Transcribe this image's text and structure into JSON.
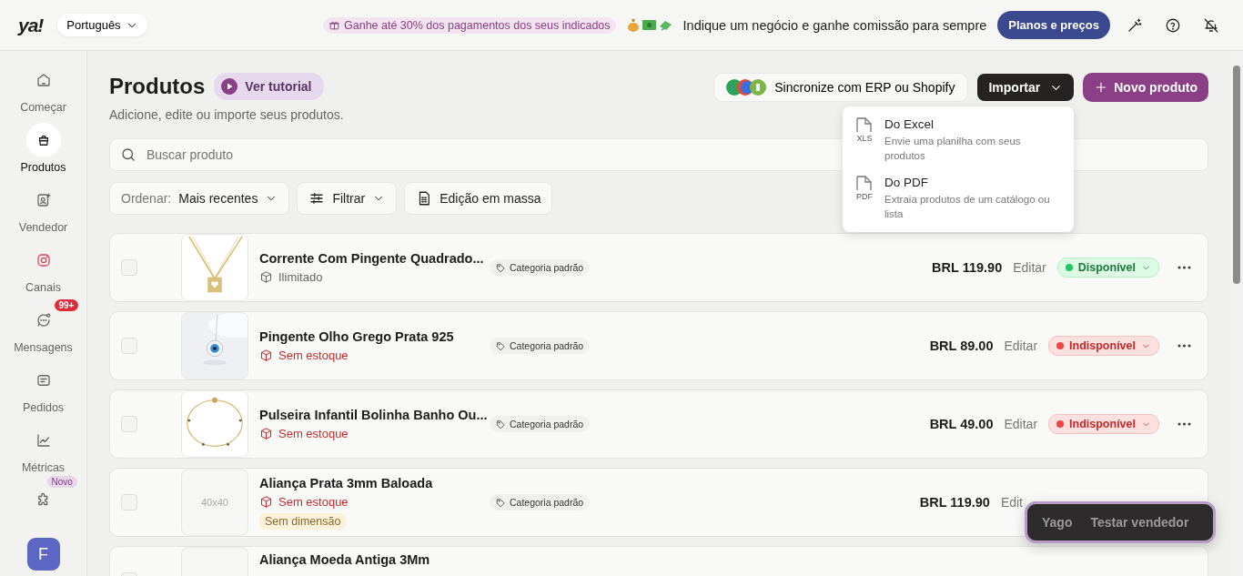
{
  "topbar": {
    "logo": "ya!",
    "language": "Português",
    "promo": "Ganhe até 30% dos pagamentos dos seus indicados",
    "referral": "Indique um negócio e ganhe comissão para sempre",
    "plans_button": "Planos e preços"
  },
  "sidebar": {
    "items": [
      {
        "kind": "home",
        "label": "Começar",
        "selected": false
      },
      {
        "kind": "products",
        "label": "Produtos",
        "selected": true
      },
      {
        "kind": "seller",
        "label": "Vendedor",
        "selected": false
      },
      {
        "kind": "channels",
        "label": "Canais",
        "selected": false
      },
      {
        "kind": "messages",
        "label": "Mensagens",
        "selected": false,
        "badge": "99+"
      },
      {
        "kind": "orders",
        "label": "Pedidos",
        "selected": false
      },
      {
        "kind": "metrics",
        "label": "Métricas",
        "selected": false
      },
      {
        "kind": "extensions",
        "selected": false,
        "badge": "Novo"
      }
    ],
    "avatar": "F"
  },
  "header": {
    "title": "Produtos",
    "tutorial_button": "Ver tutorial",
    "subtitle": "Adicione, edite ou importe seus produtos.",
    "sync_button": "Sincronize com ERP ou Shopify",
    "import_button": "Importar",
    "new_button": "Novo produto"
  },
  "import_menu": {
    "items": [
      {
        "title": "Do Excel",
        "description": "Envie uma planilha com seus produtos",
        "file_type": "XLS"
      },
      {
        "title": "Do PDF",
        "description": "Extraia produtos de um catálogo ou lista",
        "file_type": "PDF"
      }
    ]
  },
  "search": {
    "placeholder": "Buscar produto"
  },
  "toolbar": {
    "sort_label": "Ordenar:",
    "sort_value": "Mais recentes",
    "filter": "Filtrar",
    "bulk_edit": "Edição em massa"
  },
  "products": [
    {
      "checked": false,
      "name": "Corrente Com Pingente Quadrado...",
      "stock": "Ilimitado",
      "out_of_stock": false,
      "category": "Categoria padrão",
      "price": "BRL 119.90",
      "edit": "Editar",
      "status": "Disponível",
      "available": true
    },
    {
      "checked": false,
      "name": "Pingente Olho Grego Prata 925",
      "stock": "Sem estoque",
      "out_of_stock": true,
      "category": "Categoria padrão",
      "price": "BRL 89.00",
      "edit": "Editar",
      "status": "Indisponível",
      "available": false
    },
    {
      "checked": false,
      "name": "Pulseira Infantil Bolinha Banho Ou...",
      "stock": "Sem estoque",
      "out_of_stock": true,
      "category": "Categoria padrão",
      "price": "BRL 49.00",
      "edit": "Editar",
      "status": "Indisponível",
      "available": false
    },
    {
      "checked": false,
      "placeholder_text": "40x40",
      "name": "Aliança Prata 3mm Baloada",
      "stock": "Sem estoque",
      "out_of_stock": true,
      "dimension_tag": "Sem dimensão",
      "category": "Categoria padrão",
      "price": "BRL 119.90",
      "edit": "Edit"
    },
    {
      "checked": false,
      "name": "Aliança Moeda Antiga 3Mm"
    }
  ],
  "floating_widget": {
    "name": "Yago",
    "action": "Testar vendedor"
  }
}
